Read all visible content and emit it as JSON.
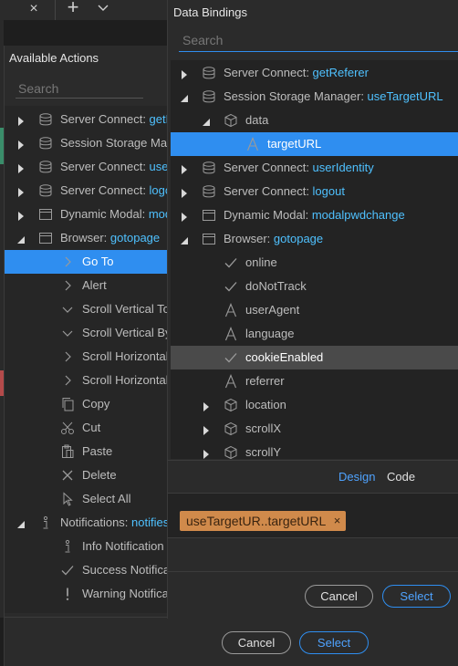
{
  "tabbar": {
    "close_glyph": "×",
    "plus_glyph": "+"
  },
  "outer": {
    "title": "Available Actions",
    "search_placeholder": "Search",
    "items": [
      {
        "prefix": "Server Connect: ",
        "name": "getR",
        "icon": "database-icon",
        "expand": "collapsed"
      },
      {
        "prefix": "Session Storage Manag",
        "name": "",
        "icon": "database-icon",
        "expand": "collapsed"
      },
      {
        "prefix": "Server Connect: ",
        "name": "user",
        "icon": "database-icon",
        "expand": "collapsed"
      },
      {
        "prefix": "Server Connect: ",
        "name": "logo",
        "icon": "database-icon",
        "expand": "collapsed"
      },
      {
        "prefix": "Dynamic Modal: ",
        "name": "mod",
        "icon": "window-icon",
        "expand": "collapsed"
      },
      {
        "prefix": "Browser: ",
        "name": "gotopage",
        "icon": "window-icon",
        "expand": "expanded"
      },
      {
        "prefix": "Go To",
        "name": "",
        "icon": "chevron-right-icon",
        "selected": true
      },
      {
        "prefix": "Alert",
        "name": "",
        "icon": "chevron-right-icon"
      },
      {
        "prefix": "Scroll Vertical To",
        "name": "",
        "icon": "chevron-down-icon"
      },
      {
        "prefix": "Scroll Vertical By",
        "name": "",
        "icon": "chevron-down-icon"
      },
      {
        "prefix": "Scroll Horizontal",
        "name": "",
        "icon": "chevron-right-icon"
      },
      {
        "prefix": "Scroll Horizontal",
        "name": "",
        "icon": "chevron-right-icon"
      },
      {
        "prefix": "Copy",
        "name": "",
        "icon": "copy-icon"
      },
      {
        "prefix": "Cut",
        "name": "",
        "icon": "scissors-icon"
      },
      {
        "prefix": "Paste",
        "name": "",
        "icon": "paste-icon"
      },
      {
        "prefix": "Delete",
        "name": "",
        "icon": "x-icon"
      },
      {
        "prefix": "Select All",
        "name": "",
        "icon": "cursor-icon"
      },
      {
        "prefix": "Notifications: ",
        "name": "notifies",
        "icon": "info-icon",
        "expand": "expanded"
      },
      {
        "prefix": "Info Notification",
        "name": "",
        "icon": "info-icon"
      },
      {
        "prefix": "Success Notificat",
        "name": "",
        "icon": "check-icon"
      },
      {
        "prefix": "Warning Notificat",
        "name": "",
        "icon": "exclamation-icon"
      }
    ],
    "cancel_label": "Cancel",
    "select_label": "Select"
  },
  "bindings": {
    "title": "Data Bindings",
    "search_placeholder": "Search",
    "tree": [
      {
        "prefix": "Server Connect: ",
        "name": "getReferer",
        "icon": "database-icon",
        "expand": "collapsed"
      },
      {
        "prefix": "Session Storage Manager: ",
        "name": "useTargetURL",
        "icon": "database-icon",
        "expand": "expanded"
      },
      {
        "prefix": "data",
        "name": "",
        "icon": "cube-icon",
        "expand": "expanded"
      },
      {
        "prefix": "targetURL",
        "name": "",
        "icon": "text-a-icon",
        "selected": true
      },
      {
        "prefix": "Server Connect: ",
        "name": "userIdentity",
        "icon": "database-icon",
        "expand": "collapsed"
      },
      {
        "prefix": "Server Connect: ",
        "name": "logout",
        "icon": "database-icon",
        "expand": "collapsed"
      },
      {
        "prefix": "Dynamic Modal: ",
        "name": "modalpwdchange",
        "icon": "window-icon",
        "expand": "collapsed"
      },
      {
        "prefix": "Browser: ",
        "name": "gotopage",
        "icon": "window-icon",
        "expand": "expanded"
      },
      {
        "prefix": "online",
        "name": "",
        "icon": "check-icon"
      },
      {
        "prefix": "doNotTrack",
        "name": "",
        "icon": "check-icon"
      },
      {
        "prefix": "userAgent",
        "name": "",
        "icon": "text-a-icon"
      },
      {
        "prefix": "language",
        "name": "",
        "icon": "text-a-icon"
      },
      {
        "prefix": "cookieEnabled",
        "name": "",
        "icon": "check-icon",
        "highlighted": true
      },
      {
        "prefix": "referrer",
        "name": "",
        "icon": "text-a-icon"
      },
      {
        "prefix": "location",
        "name": "",
        "icon": "cube-icon",
        "expand": "collapsed"
      },
      {
        "prefix": "scrollX",
        "name": "",
        "icon": "cube-icon",
        "expand": "collapsed"
      },
      {
        "prefix": "scrollY",
        "name": "",
        "icon": "cube-icon",
        "expand": "collapsed"
      }
    ],
    "tab_design": "Design",
    "tab_code": "Code",
    "expression_chip": "useTargetUR..targetURL",
    "chip_remove": "×",
    "cancel_label": "Cancel",
    "select_label": "Select"
  }
}
